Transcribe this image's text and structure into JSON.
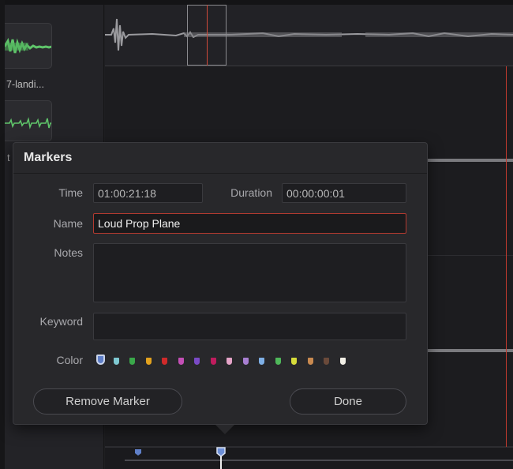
{
  "media_pool": {
    "clip1_label": "7-landi...",
    "partial_letter": "t"
  },
  "dialog": {
    "title": "Markers",
    "time_label": "Time",
    "time_value": "01:00:21:18",
    "duration_label": "Duration",
    "duration_value": "00:00:00:01",
    "name_label": "Name",
    "name_value": "Loud Prop Plane",
    "notes_label": "Notes",
    "notes_value": "",
    "keyword_label": "Keyword",
    "keyword_value": "",
    "color_label": "Color",
    "colors": [
      "#5f7fc8",
      "#7fc9d2",
      "#3aa84a",
      "#e3a21e",
      "#d02a2a",
      "#c44fb6",
      "#7a4ac6",
      "#c01c5e",
      "#e5a4c8",
      "#a87fd2",
      "#7fb0e6",
      "#4fb85a",
      "#d6dc3a",
      "#c98a50",
      "#6a4a3a",
      "#f2efe6"
    ],
    "selected_color": "#5f7fc8",
    "remove_label": "Remove Marker",
    "done_label": "Done"
  },
  "timeline": {
    "playhead_color": "#c23a2e",
    "marker_color": "#5f7fc8"
  }
}
